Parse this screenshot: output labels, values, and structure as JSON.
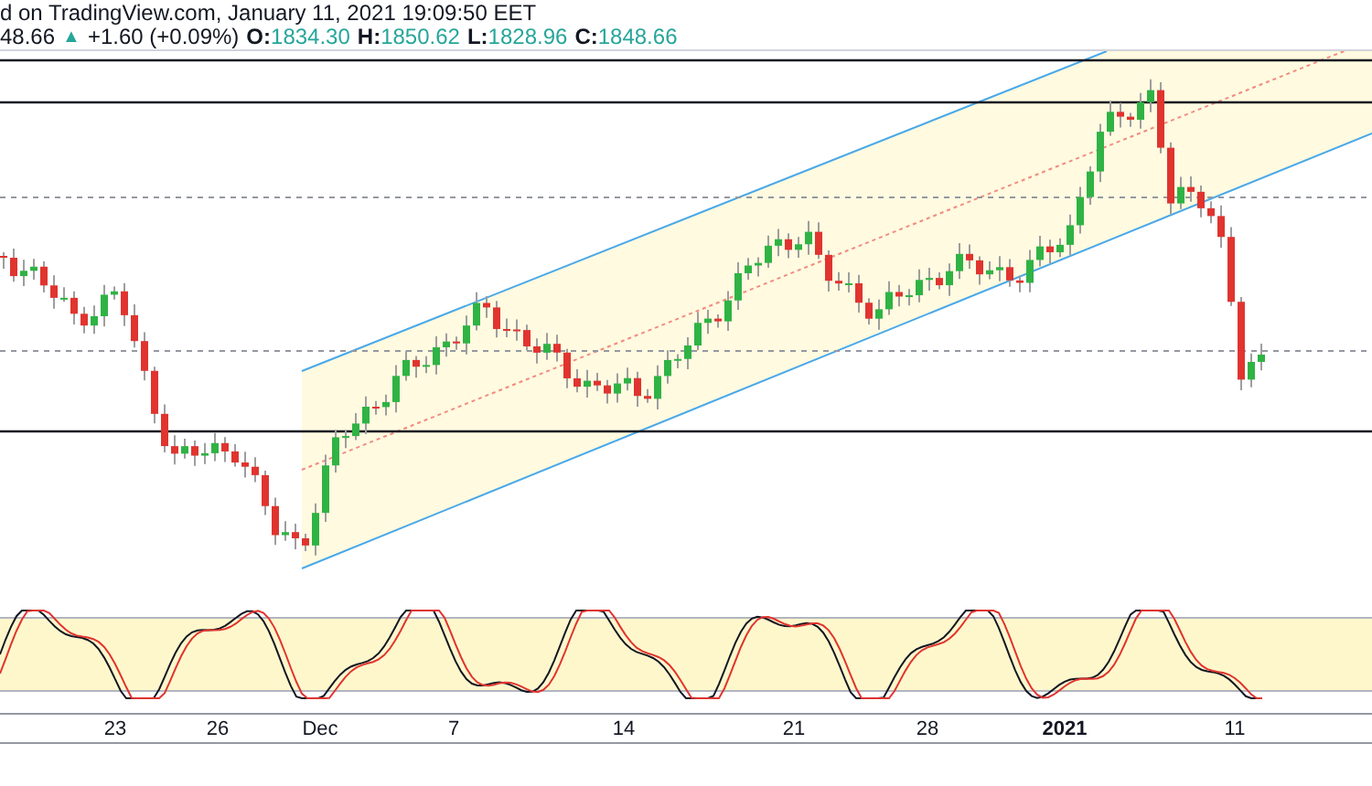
{
  "header": {
    "title_line": "d on TradingView.com, January 11, 2021 19:09:50 EET",
    "price": "48.66",
    "change_icon": "▲",
    "change": "+1.60 (+0.09%)",
    "ohlc": [
      {
        "label": "O:",
        "value": "1834.30"
      },
      {
        "label": "H:",
        "value": "1850.62"
      },
      {
        "label": "L:",
        "value": "1828.96"
      },
      {
        "label": "C:",
        "value": "1848.66"
      }
    ]
  },
  "x_axis": [
    {
      "label": "23",
      "emphasized": false
    },
    {
      "label": "26",
      "emphasized": false
    },
    {
      "label": "Dec",
      "emphasized": false
    },
    {
      "label": "7",
      "emphasized": false
    },
    {
      "label": "14",
      "emphasized": false
    },
    {
      "label": "21",
      "emphasized": false
    },
    {
      "label": "28",
      "emphasized": false
    },
    {
      "label": "2021",
      "emphasized": true
    },
    {
      "label": "11",
      "emphasized": false
    }
  ]
}
